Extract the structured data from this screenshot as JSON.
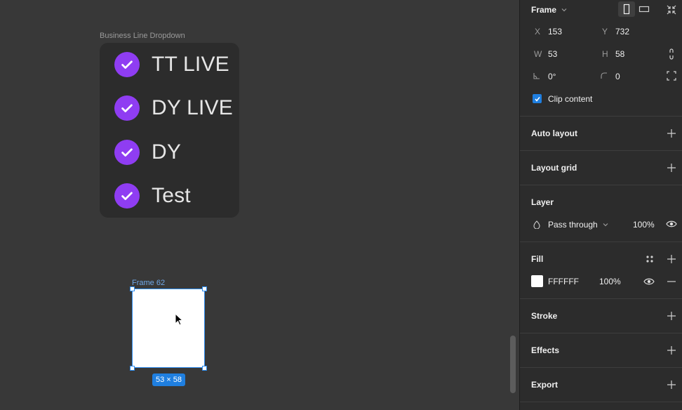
{
  "canvas": {
    "dropdown_frame_label": "Business Line Dropdown",
    "dropdown_items": [
      {
        "label": "TT LIVE",
        "checked": true
      },
      {
        "label": "DY LIVE",
        "checked": true
      },
      {
        "label": "DY",
        "checked": true
      },
      {
        "label": "Test",
        "checked": true
      }
    ],
    "check_color": "#8f3df2",
    "frame62_label": "Frame 62",
    "frame62_size": "53 × 58"
  },
  "panel": {
    "frame_title": "Frame",
    "x_label": "X",
    "x_value": "153",
    "y_label": "Y",
    "y_value": "732",
    "w_label": "W",
    "w_value": "53",
    "h_label": "H",
    "h_value": "58",
    "rotation_value": "0°",
    "radius_value": "0",
    "clip_content_label": "Clip content",
    "auto_layout": "Auto layout",
    "layout_grid": "Layout grid",
    "layer_title": "Layer",
    "blend_mode": "Pass through",
    "layer_opacity": "100%",
    "fill_title": "Fill",
    "fill_hex": "FFFFFF",
    "fill_opacity": "100%",
    "stroke": "Stroke",
    "effects": "Effects",
    "export": "Export",
    "accent": "#1f7fe0"
  }
}
